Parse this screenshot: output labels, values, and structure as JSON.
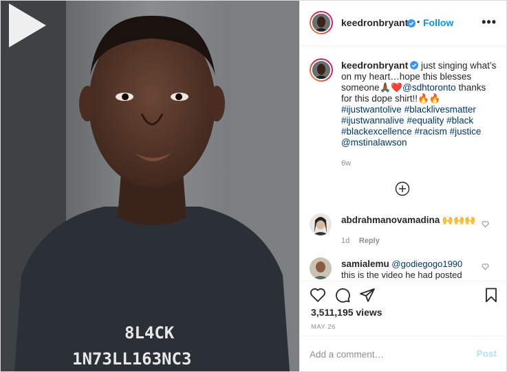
{
  "header": {
    "username": "keedronbryant",
    "dot": "•",
    "follow_label": "Follow",
    "more_icon": "more-dots-icon"
  },
  "caption": {
    "username": "keedronbryant",
    "text_1": "just singing what’s on my heart…hope this blesses someone",
    "emoji_1": "🙏🏾❤️",
    "mention_1": "@sdhtoronto",
    "text_2": "thanks for this dope shirt!!",
    "emoji_2": "🔥🔥",
    "hashtags": [
      "#ijustwantolive",
      "#blacklivesmatter",
      "#ijustwannalive",
      "#equality",
      "#black",
      "#blackexcellence",
      "#racism",
      "#justice"
    ],
    "mention_2": "@mstinalawson",
    "time": "6w"
  },
  "comments": [
    {
      "username": "abdrahmanovamadina",
      "text": "🙌🙌🙌",
      "time": "1d",
      "reply_label": "Reply"
    },
    {
      "username": "samialemu",
      "mention": "@godiegogo1990",
      "text": "this is the video he had posted"
    }
  ],
  "shirt": {
    "line1": "8L4CK",
    "line2": "1N73LL163NC3"
  },
  "stats": {
    "views": "3,511,195 views",
    "date": "MAY 26"
  },
  "add_comment": {
    "placeholder": "Add a comment…",
    "post_label": "Post"
  },
  "colors": {
    "accent": "#0095f6",
    "link": "#00376b",
    "muted": "#8e8e8e",
    "post_disabled": "#b2dffc"
  }
}
